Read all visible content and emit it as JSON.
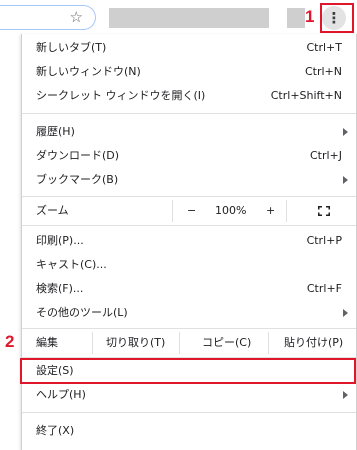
{
  "toolbar": {
    "star_glyph": "☆",
    "kebab_glyph": "⋮",
    "badge_1": "1",
    "badge_2": "2"
  },
  "menu": {
    "new_tab": "新しいタブ(T)",
    "new_tab_shortcut": "Ctrl+T",
    "new_window": "新しいウィンドウ(N)",
    "new_window_shortcut": "Ctrl+N",
    "incognito": "シークレット ウィンドウを開く(I)",
    "incognito_shortcut": "Ctrl+Shift+N",
    "history": "履歴(H)",
    "downloads": "ダウンロード(D)",
    "downloads_shortcut": "Ctrl+J",
    "bookmarks": "ブックマーク(B)",
    "zoom_label": "ズーム",
    "zoom_minus": "−",
    "zoom_value": "100%",
    "zoom_plus": "+",
    "print": "印刷(P)...",
    "print_shortcut": "Ctrl+P",
    "cast": "キャスト(C)...",
    "find": "検索(F)...",
    "find_shortcut": "Ctrl+F",
    "more_tools": "その他のツール(L)",
    "edit_label": "編集",
    "cut": "切り取り(T)",
    "copy": "コピー(C)",
    "paste": "貼り付け(P)",
    "settings": "設定(S)",
    "help": "ヘルプ(H)",
    "exit": "終了(X)"
  }
}
